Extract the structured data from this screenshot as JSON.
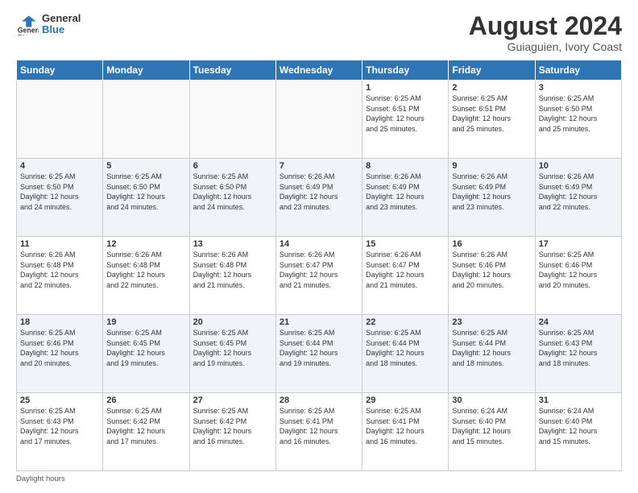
{
  "logo": {
    "line1": "General",
    "line2": "Blue"
  },
  "title": "August 2024",
  "subtitle": "Guiaguien, Ivory Coast",
  "days_header": [
    "Sunday",
    "Monday",
    "Tuesday",
    "Wednesday",
    "Thursday",
    "Friday",
    "Saturday"
  ],
  "footer_text": "Daylight hours",
  "weeks": [
    [
      {
        "num": "",
        "info": ""
      },
      {
        "num": "",
        "info": ""
      },
      {
        "num": "",
        "info": ""
      },
      {
        "num": "",
        "info": ""
      },
      {
        "num": "1",
        "info": "Sunrise: 6:25 AM\nSunset: 6:51 PM\nDaylight: 12 hours\nand 25 minutes."
      },
      {
        "num": "2",
        "info": "Sunrise: 6:25 AM\nSunset: 6:51 PM\nDaylight: 12 hours\nand 25 minutes."
      },
      {
        "num": "3",
        "info": "Sunrise: 6:25 AM\nSunset: 6:50 PM\nDaylight: 12 hours\nand 25 minutes."
      }
    ],
    [
      {
        "num": "4",
        "info": "Sunrise: 6:25 AM\nSunset: 6:50 PM\nDaylight: 12 hours\nand 24 minutes."
      },
      {
        "num": "5",
        "info": "Sunrise: 6:25 AM\nSunset: 6:50 PM\nDaylight: 12 hours\nand 24 minutes."
      },
      {
        "num": "6",
        "info": "Sunrise: 6:25 AM\nSunset: 6:50 PM\nDaylight: 12 hours\nand 24 minutes."
      },
      {
        "num": "7",
        "info": "Sunrise: 6:26 AM\nSunset: 6:49 PM\nDaylight: 12 hours\nand 23 minutes."
      },
      {
        "num": "8",
        "info": "Sunrise: 6:26 AM\nSunset: 6:49 PM\nDaylight: 12 hours\nand 23 minutes."
      },
      {
        "num": "9",
        "info": "Sunrise: 6:26 AM\nSunset: 6:49 PM\nDaylight: 12 hours\nand 23 minutes."
      },
      {
        "num": "10",
        "info": "Sunrise: 6:26 AM\nSunset: 6:49 PM\nDaylight: 12 hours\nand 22 minutes."
      }
    ],
    [
      {
        "num": "11",
        "info": "Sunrise: 6:26 AM\nSunset: 6:48 PM\nDaylight: 12 hours\nand 22 minutes."
      },
      {
        "num": "12",
        "info": "Sunrise: 6:26 AM\nSunset: 6:48 PM\nDaylight: 12 hours\nand 22 minutes."
      },
      {
        "num": "13",
        "info": "Sunrise: 6:26 AM\nSunset: 6:48 PM\nDaylight: 12 hours\nand 21 minutes."
      },
      {
        "num": "14",
        "info": "Sunrise: 6:26 AM\nSunset: 6:47 PM\nDaylight: 12 hours\nand 21 minutes."
      },
      {
        "num": "15",
        "info": "Sunrise: 6:26 AM\nSunset: 6:47 PM\nDaylight: 12 hours\nand 21 minutes."
      },
      {
        "num": "16",
        "info": "Sunrise: 6:26 AM\nSunset: 6:46 PM\nDaylight: 12 hours\nand 20 minutes."
      },
      {
        "num": "17",
        "info": "Sunrise: 6:25 AM\nSunset: 6:46 PM\nDaylight: 12 hours\nand 20 minutes."
      }
    ],
    [
      {
        "num": "18",
        "info": "Sunrise: 6:25 AM\nSunset: 6:46 PM\nDaylight: 12 hours\nand 20 minutes."
      },
      {
        "num": "19",
        "info": "Sunrise: 6:25 AM\nSunset: 6:45 PM\nDaylight: 12 hours\nand 19 minutes."
      },
      {
        "num": "20",
        "info": "Sunrise: 6:25 AM\nSunset: 6:45 PM\nDaylight: 12 hours\nand 19 minutes."
      },
      {
        "num": "21",
        "info": "Sunrise: 6:25 AM\nSunset: 6:44 PM\nDaylight: 12 hours\nand 19 minutes."
      },
      {
        "num": "22",
        "info": "Sunrise: 6:25 AM\nSunset: 6:44 PM\nDaylight: 12 hours\nand 18 minutes."
      },
      {
        "num": "23",
        "info": "Sunrise: 6:25 AM\nSunset: 6:44 PM\nDaylight: 12 hours\nand 18 minutes."
      },
      {
        "num": "24",
        "info": "Sunrise: 6:25 AM\nSunset: 6:43 PM\nDaylight: 12 hours\nand 18 minutes."
      }
    ],
    [
      {
        "num": "25",
        "info": "Sunrise: 6:25 AM\nSunset: 6:43 PM\nDaylight: 12 hours\nand 17 minutes."
      },
      {
        "num": "26",
        "info": "Sunrise: 6:25 AM\nSunset: 6:42 PM\nDaylight: 12 hours\nand 17 minutes."
      },
      {
        "num": "27",
        "info": "Sunrise: 6:25 AM\nSunset: 6:42 PM\nDaylight: 12 hours\nand 16 minutes."
      },
      {
        "num": "28",
        "info": "Sunrise: 6:25 AM\nSunset: 6:41 PM\nDaylight: 12 hours\nand 16 minutes."
      },
      {
        "num": "29",
        "info": "Sunrise: 6:25 AM\nSunset: 6:41 PM\nDaylight: 12 hours\nand 16 minutes."
      },
      {
        "num": "30",
        "info": "Sunrise: 6:24 AM\nSunset: 6:40 PM\nDaylight: 12 hours\nand 15 minutes."
      },
      {
        "num": "31",
        "info": "Sunrise: 6:24 AM\nSunset: 6:40 PM\nDaylight: 12 hours\nand 15 minutes."
      }
    ]
  ]
}
